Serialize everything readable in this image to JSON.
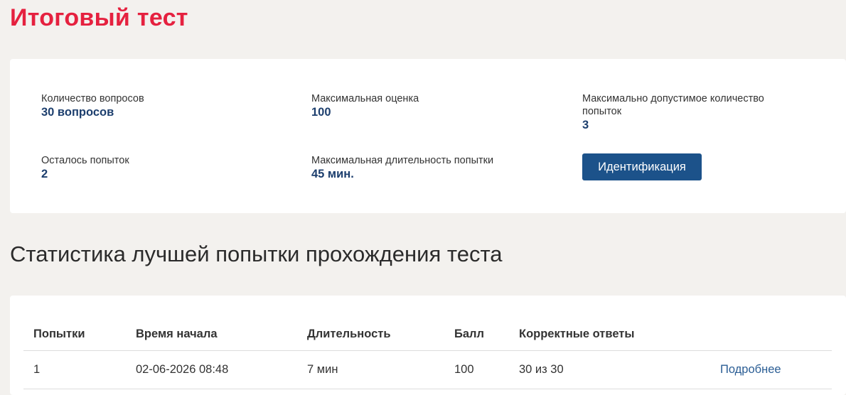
{
  "page_title": "Итоговый тест",
  "info": {
    "questions_label": "Количество вопросов",
    "questions_value": "30 вопросов",
    "max_grade_label": "Максимальная оценка",
    "max_grade_value": "100",
    "max_attempts_label": "Максимально допустимое количество попыток",
    "max_attempts_value": "3",
    "remaining_label": "Осталось попыток",
    "remaining_value": "2",
    "max_duration_label": "Максимальная длительность попытки",
    "max_duration_value": "45 мин.",
    "identify_button": "Идентификация"
  },
  "stats": {
    "title": "Статистика лучшей попытки прохождения теста",
    "columns": [
      "Попытки",
      "Время начала",
      "Длительность",
      "Балл",
      "Корректные ответы",
      ""
    ],
    "rows": [
      [
        "1",
        "02-06-2026 08:48",
        "7 мин",
        "100",
        "30 из 30",
        "Подробнее"
      ]
    ]
  }
}
